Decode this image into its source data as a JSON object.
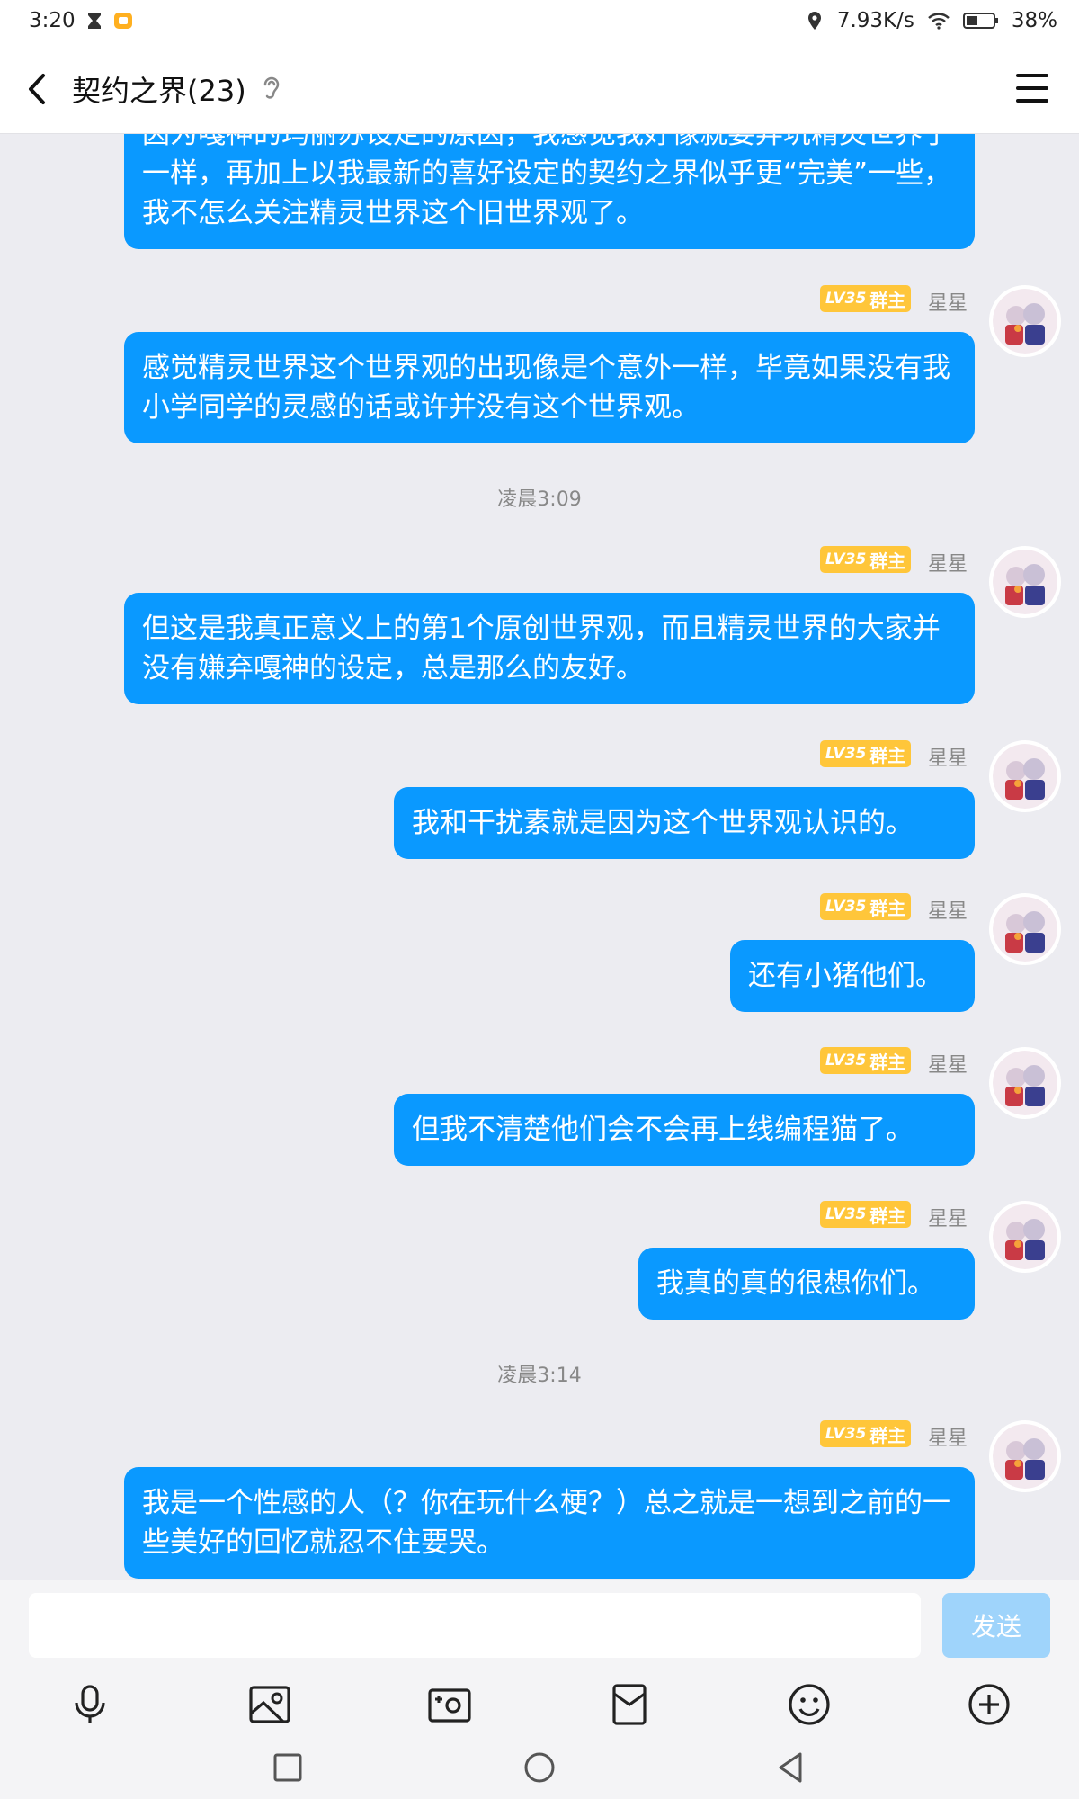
{
  "status_bar": {
    "time": "3:20",
    "net_speed": "7.93K/s",
    "battery": "38%",
    "icons": [
      "hourglass-icon",
      "app-notification-icon",
      "location-icon",
      "wifi-icon",
      "battery-icon"
    ]
  },
  "header": {
    "title": "契约之界(23)",
    "icons": [
      "back-icon",
      "ear-icon",
      "menu-icon"
    ]
  },
  "badge": {
    "level": "LV35",
    "role": "群主"
  },
  "sender_name": "星星",
  "messages": [
    {
      "text": "因为嘎神的玛丽苏设定的原因，我感觉我好像就要弃坑精灵世界了一样，再加上以我最新的喜好设定的契约之界似乎更“完美”一些，我不怎么关注精灵世界这个旧世界观了。"
    },
    {
      "text": "感觉精灵世界这个世界观的出现像是个意外一样，毕竟如果没有我小学同学的灵感的话或许并没有这个世界观。"
    },
    {
      "text": "但这是我真正意义上的第1个原创世界观，而且精灵世界的大家并没有嫌弃嘎神的设定，总是那么的友好。"
    },
    {
      "text": "我和干扰素就是因为这个世界观认识的。"
    },
    {
      "text": "还有小猪他们。"
    },
    {
      "text": "但我不清楚他们会不会再上线编程猫了。"
    },
    {
      "text": "我真的真的很想你们。"
    },
    {
      "text": "我是一个性感的人（？你在玩什么梗？）总之就是一想到之前的一些美好的回忆就忍不住要哭。"
    }
  ],
  "timestamps": [
    "凌晨3:09",
    "凌晨3:14"
  ],
  "input": {
    "placeholder": "",
    "send_label": "发送"
  },
  "toolbar": [
    "microphone-icon",
    "image-icon",
    "camera-icon",
    "red-packet-icon",
    "emoji-icon",
    "plus-icon"
  ],
  "nav": [
    "recent-apps-icon",
    "home-icon",
    "back-nav-icon"
  ],
  "colors": {
    "bubble": "#0a99ff",
    "badge": "#ffc63a",
    "send_disabled": "#9fd4fb",
    "background": "#ececf1"
  }
}
